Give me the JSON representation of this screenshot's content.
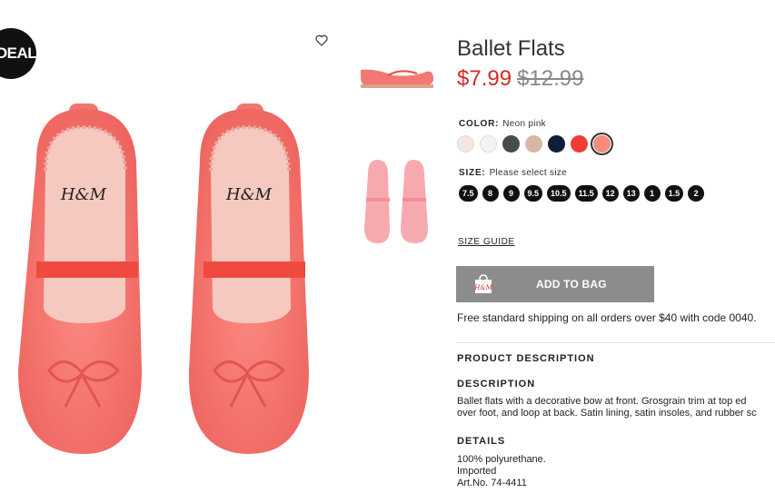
{
  "badge": {
    "label": "DEAL"
  },
  "product": {
    "title": "Ballet Flats",
    "price_now": "$7.99",
    "price_old": "$12.99"
  },
  "color": {
    "label": "COLOR:",
    "selected": "Neon pink",
    "swatches": [
      "#f4e7e1",
      "#f3f3f1",
      "#4a4a4a",
      "#d8b8a4",
      "#0f1c3a",
      "#ef3c34",
      "#f48b7d"
    ]
  },
  "size": {
    "label": "SIZE:",
    "prompt": "Please select size",
    "options": [
      "7.5",
      "8",
      "9",
      "9.5",
      "10.5",
      "11.5",
      "12",
      "13",
      "1",
      "1.5",
      "2"
    ]
  },
  "size_guide": "SIZE GUIDE",
  "add_to_bag": "ADD TO BAG",
  "bag_icon_text": "H&M",
  "shipping": "Free standard shipping on all orders over $40 with code 0040.",
  "product_description": "PRODUCT DESCRIPTION",
  "description": {
    "heading": "DESCRIPTION",
    "line1": "Ballet flats with a decorative bow at front. Grosgrain trim at top ed",
    "line2": "over foot, and loop at back. Satin lining, satin insoles, and rubber sc"
  },
  "details": {
    "heading": "DETAILS",
    "lines": [
      "100% polyurethane.",
      "Imported",
      "Art.No. 74-4411"
    ]
  },
  "images": {
    "logo_text": "H&M"
  },
  "colors": {
    "price_sale": "#d42a26",
    "button_bg": "#8c8c8c",
    "shoe": "#f26d6a"
  }
}
